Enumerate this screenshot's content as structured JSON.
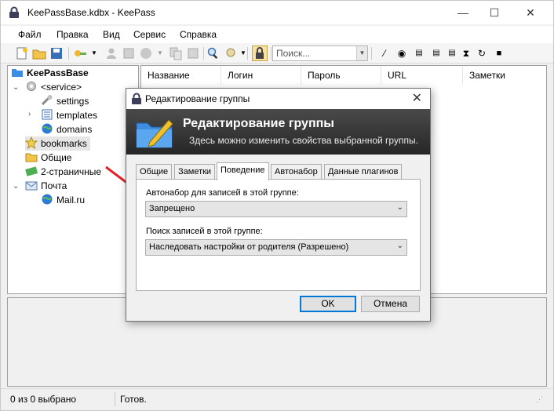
{
  "window": {
    "title": "KeePassBase.kdbx - KeePass",
    "min": "—",
    "max": "☐",
    "close": "✕"
  },
  "menu": [
    "Файл",
    "Правка",
    "Вид",
    "Сервис",
    "Справка"
  ],
  "toolbar": {
    "search_placeholder": "Поиск...",
    "search_drop": "▼"
  },
  "tree": {
    "root": "KeePassBase",
    "items": [
      "<service>",
      "settings",
      "templates",
      "domains",
      "bookmarks",
      "Общие",
      "2-страничные",
      "Почта",
      "Mail.ru"
    ]
  },
  "list": {
    "columns": [
      "Название",
      "Логин",
      "Пароль",
      "URL",
      "Заметки"
    ]
  },
  "status": {
    "selection": "0 из 0 выбрано",
    "state": "Готов."
  },
  "dialog": {
    "title": "Редактирование группы",
    "close": "✕",
    "banner_title": "Редактирование группы",
    "banner_subtitle": "Здесь можно изменить свойства выбранной группы.",
    "tabs": [
      "Общие",
      "Заметки",
      "Поведение",
      "Автонабор",
      "Данные плагинов"
    ],
    "active_tab": "Поведение",
    "autotype_label": "Автонабор для записей в этой группе:",
    "autotype_value": "Запрещено",
    "search_label": "Поиск записей в этой группе:",
    "search_value": "Наследовать настройки от родителя (Разрешено)",
    "ok": "OK",
    "cancel": "Отмена"
  },
  "colors": {
    "accent": "#0078d7",
    "arrow": "#e0232a",
    "banner_dark": "#262626"
  }
}
